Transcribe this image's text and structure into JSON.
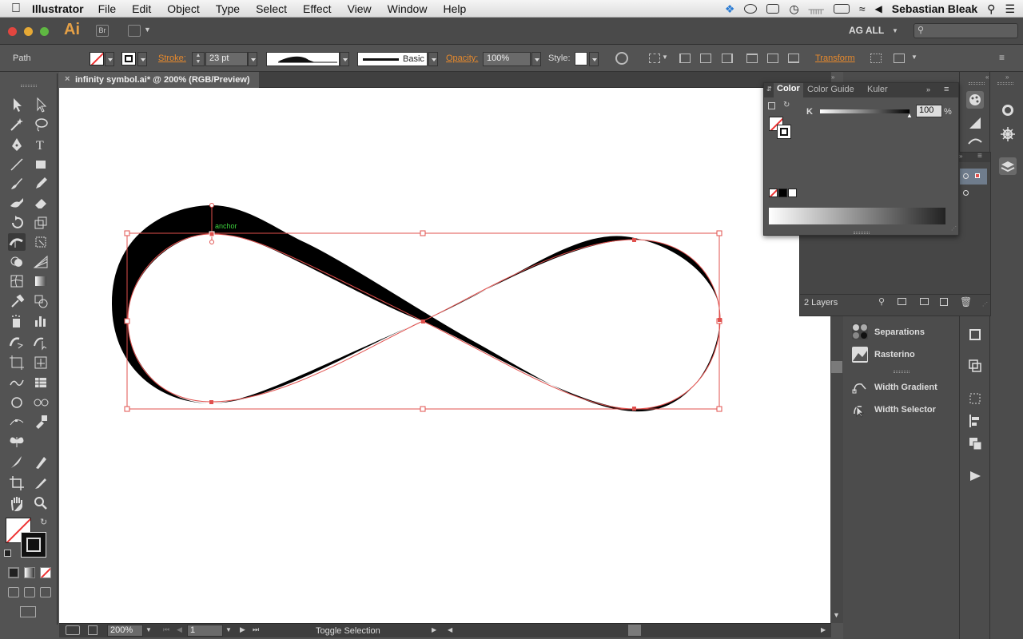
{
  "menubar": {
    "app_name": "Illustrator",
    "items": [
      "File",
      "Edit",
      "Object",
      "Type",
      "Select",
      "Effect",
      "View",
      "Window",
      "Help"
    ],
    "user": "Sebastian Bleak"
  },
  "appbar": {
    "logo": "Ai",
    "bridge": "Br",
    "workspace": "AG ALL",
    "search_placeholder": ""
  },
  "control": {
    "selection_type": "Path",
    "stroke_label": "Stroke:",
    "stroke_weight": "23 pt",
    "brush_label": "Basic",
    "opacity_label": "Opacity:",
    "opacity_value": "100%",
    "style_label": "Style:",
    "transform_label": "Transform"
  },
  "document": {
    "tab_title": "infinity symbol.ai* @ 200% (RGB/Preview)",
    "anchor_hint": "anchor"
  },
  "status": {
    "zoom": "200%",
    "artboard": "1",
    "text": "Toggle Selection"
  },
  "color_panel": {
    "tabs": [
      "Color",
      "Color Guide",
      "Kuler"
    ],
    "channel": "K",
    "value": "100",
    "unit": "%"
  },
  "layers_panel": {
    "count_label": "2 Layers"
  },
  "plugins": [
    "Separations",
    "Rasterino",
    "Width Gradient",
    "Width Selector"
  ],
  "colors": {
    "accent": "#e88a2c",
    "path_highlight": "#e0504d",
    "anchor_text": "#3fd23f"
  }
}
